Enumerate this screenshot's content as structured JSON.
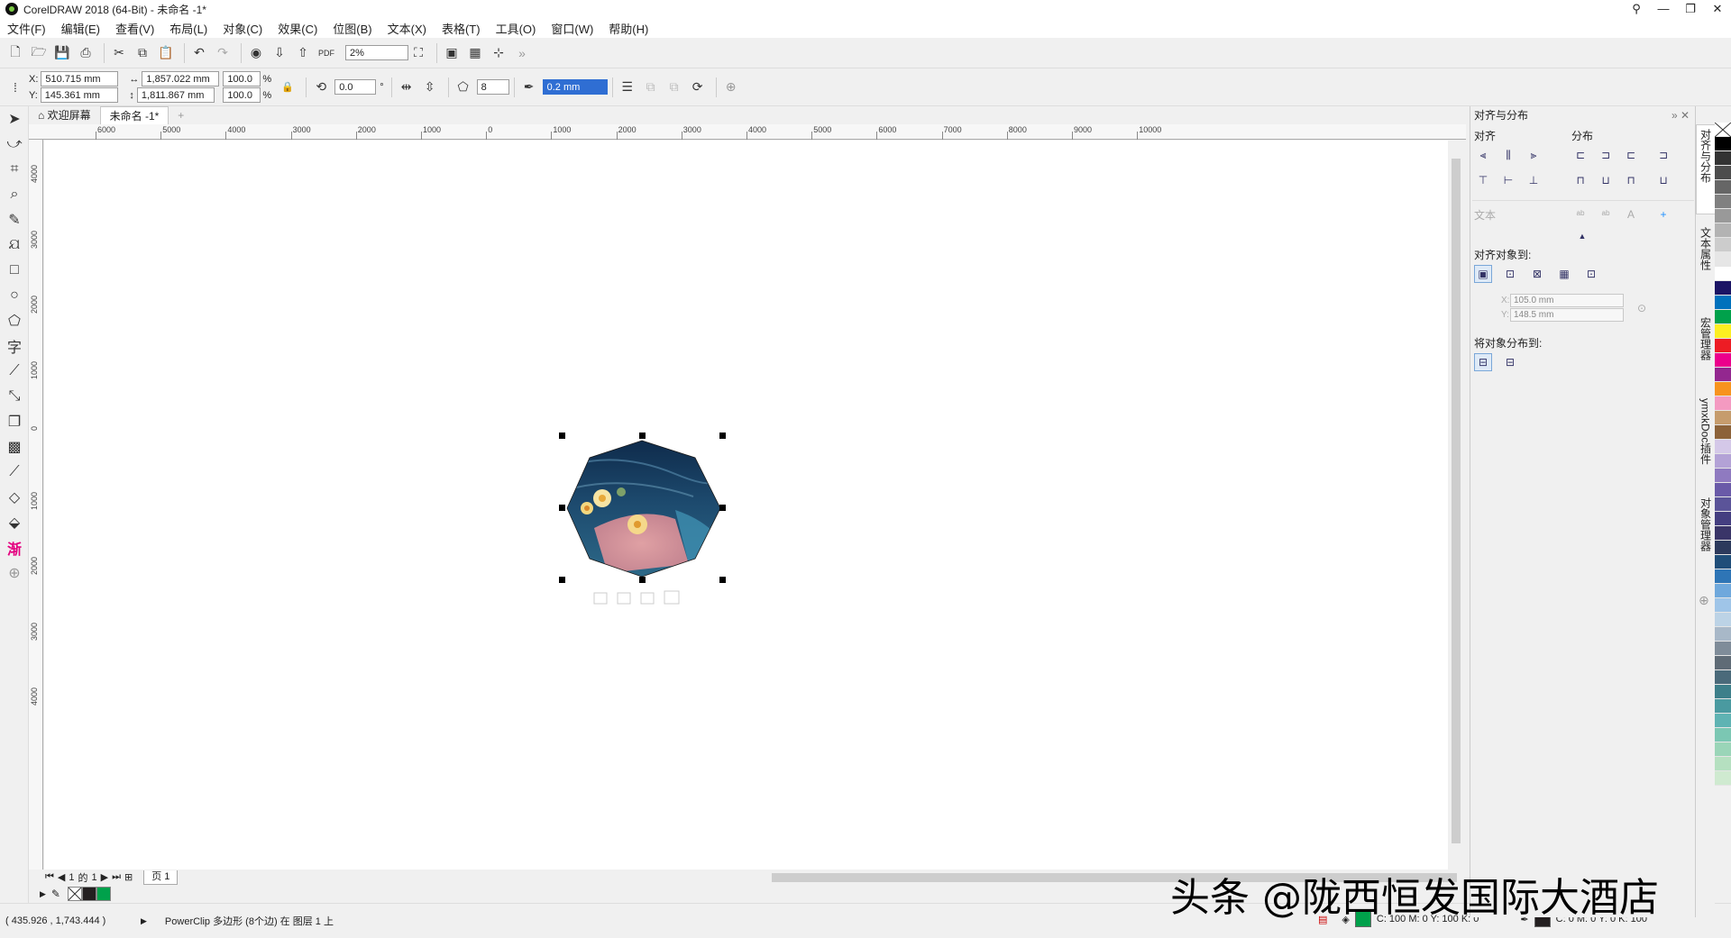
{
  "window": {
    "title": "CorelDRAW 2018 (64-Bit) - 未命名 -1*",
    "controls": [
      "—",
      "❐",
      "✕"
    ]
  },
  "menu": [
    "文件(F)",
    "编辑(E)",
    "查看(V)",
    "布局(L)",
    "对象(C)",
    "效果(C)",
    "位图(B)",
    "文本(X)",
    "表格(T)",
    "工具(O)",
    "窗口(W)",
    "帮助(H)"
  ],
  "toolbar": {
    "zoom": "2%",
    "pdf_label": "PDF"
  },
  "propbar": {
    "x_label": "X:",
    "x_value": "510.715 mm",
    "y_label": "Y:",
    "y_value": "145.361 mm",
    "width_value": "1,857.022 mm",
    "height_value": "1,811.867 mm",
    "scale_w": "100.0",
    "scale_h": "100.0",
    "percent": "%",
    "rotation": "0.0",
    "rotation_unit": "°",
    "sides": "8",
    "outline": "0.2 mm"
  },
  "tabs": {
    "welcome": "欢迎屏幕",
    "document": "未命名 -1*",
    "add": "+"
  },
  "rulers": {
    "h_ticks": [
      "6000",
      "5000",
      "4000",
      "3000",
      "2000",
      "1000",
      "0",
      "1000",
      "2000",
      "3000",
      "4000",
      "5000",
      "6000",
      "7000",
      "8000",
      "9000",
      "10000"
    ],
    "v_ticks": [
      "4000",
      "3000",
      "2000",
      "1000",
      "0",
      "1000",
      "2000",
      "3000",
      "4000"
    ]
  },
  "pagenav": {
    "current": "1",
    "of": "的",
    "total": "1",
    "page_tab": "页 1"
  },
  "docker": {
    "title": "对齐与分布",
    "align_label": "对齐",
    "distribute_label": "分布",
    "text_label": "文本",
    "align_to_label": "对齐对象到:",
    "x_field": "105.0 mm",
    "y_field": "148.5 mm",
    "distribute_to_label": "将对象分布到:",
    "x_label": "X:",
    "y_label": "Y:"
  },
  "vertical_tabs": [
    "对齐与分布",
    "文本属性",
    "宏管理器",
    "ymxkDoc插件",
    "对象管理器"
  ],
  "status": {
    "coords": "( 435.926 , 1,743.444 )",
    "object_info": "PowerClip 多边形 (8个边) 在 图层 1 上",
    "fill_info": "C: 100 M: 0 Y: 100 K: 0",
    "outline_info": "C: 0 M: 0 Y: 0 K: 100"
  },
  "watermark": "头条 @陇西恒发国际大酒店",
  "colors": {
    "fill_swatch": "#00a14b",
    "outline_swatch": "#231f20",
    "selection_blue": "#2f6ed3"
  },
  "palette_colors": [
    "#000000",
    "#333333",
    "#4d4d4d",
    "#666666",
    "#808080",
    "#999999",
    "#b3b3b3",
    "#cccccc",
    "#e6e6e6",
    "#ffffff",
    "#1b1464",
    "#0071bc",
    "#00a14b",
    "#fcee21",
    "#ed1c24",
    "#ec008c",
    "#93278f",
    "#f7931e",
    "#f49ac1",
    "#c69c6d",
    "#8c6239",
    "#d4c8e8",
    "#b3a2d6",
    "#8f7ac0",
    "#6a5aa8",
    "#5b5499",
    "#443e80",
    "#3a3568",
    "#2c3a5c",
    "#1f4e79",
    "#2e75b6",
    "#6fa8dc",
    "#9fc5e8",
    "#bcd3e6",
    "#a8b8c8",
    "#7f8c99",
    "#5f6b76",
    "#4a6a7a",
    "#3d7f8a",
    "#4a9aa0",
    "#5fb3b3",
    "#7bc7b3",
    "#9ad5b8",
    "#b5e0c0",
    "#cfead0"
  ]
}
